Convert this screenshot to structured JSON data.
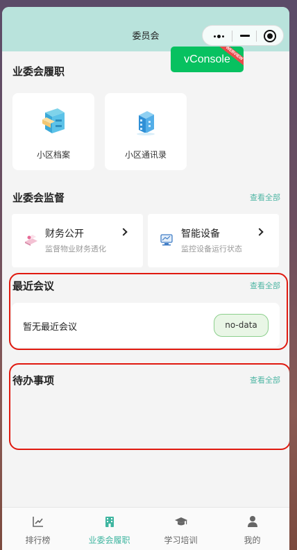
{
  "nav": {
    "title": "委员会"
  },
  "vconsole": {
    "label": "vConsole",
    "ribbon": "WEBVIEW"
  },
  "duties": {
    "title": "业委会履职",
    "tiles": [
      {
        "label": "小区档案",
        "icon": "archive-cabinet-icon"
      },
      {
        "label": "小区通讯录",
        "icon": "building-icon"
      }
    ]
  },
  "supervision": {
    "title": "业委会监督",
    "see_all": "查看全部",
    "cards": [
      {
        "title": "财务公开",
        "subtitle": "监督物业财务透化",
        "icon": "finance-icon"
      },
      {
        "title": "智能设备",
        "subtitle": "监控设备运行状态",
        "icon": "device-icon"
      }
    ]
  },
  "meetings": {
    "title": "最近会议",
    "see_all": "查看全部",
    "empty_text": "暂无最近会议",
    "badge": "no-data"
  },
  "todos": {
    "title": "待办事项",
    "see_all": "查看全部"
  },
  "tabbar": {
    "items": [
      {
        "label": "排行榜",
        "icon": "chart-icon",
        "active": false
      },
      {
        "label": "业委会履职",
        "icon": "building-icon",
        "active": true
      },
      {
        "label": "学习培训",
        "icon": "graduation-cap-icon",
        "active": false
      },
      {
        "label": "我的",
        "icon": "user-icon",
        "active": false
      }
    ]
  },
  "colors": {
    "header_bg": "#b9e3dc",
    "accent": "#4fb6a4",
    "vconsole": "#07c160",
    "annotation": "#e0190f"
  }
}
